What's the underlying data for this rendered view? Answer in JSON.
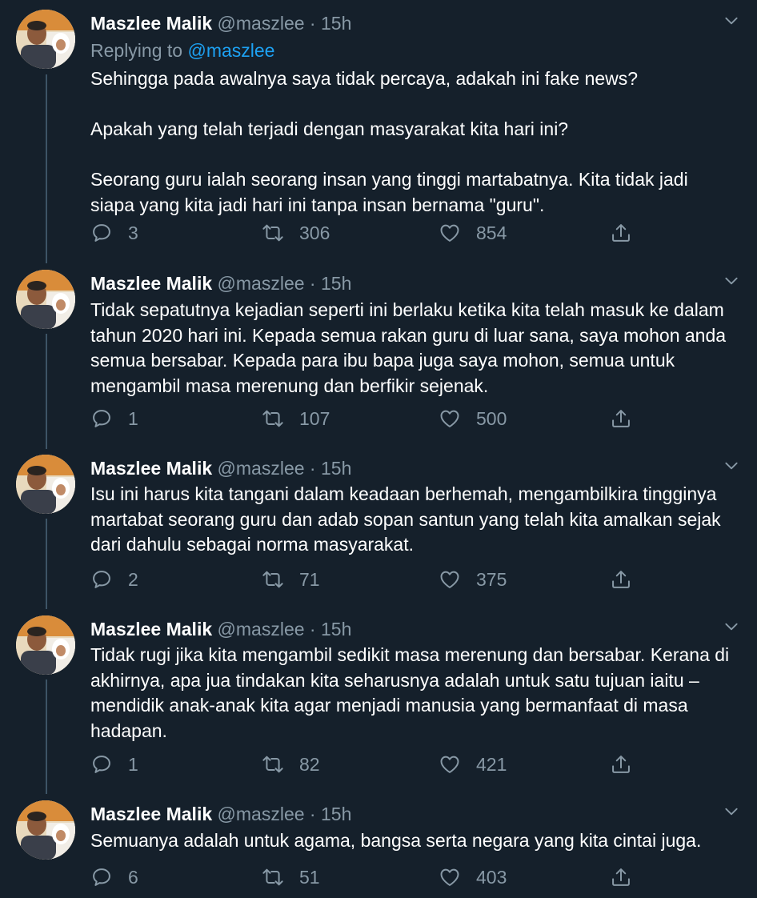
{
  "tweets": [
    {
      "name": "Maszlee Malik",
      "handle": "@maszlee",
      "dot": "·",
      "time": "15h",
      "replying_prefix": "Replying to",
      "replying_mention": "@maszlee",
      "paragraphs": [
        "Sehingga pada awalnya saya tidak percaya, adakah ini fake news?",
        "Apakah yang telah terjadi dengan masyarakat kita hari ini?",
        "Seorang guru ialah seorang insan yang tinggi martabatnya. Kita tidak jadi siapa yang kita jadi hari ini tanpa insan bernama \"guru\"."
      ],
      "replies": "3",
      "retweets": "306",
      "likes": "854"
    },
    {
      "name": "Maszlee Malik",
      "handle": "@maszlee",
      "dot": "·",
      "time": "15h",
      "paragraphs": [
        "Tidak sepatutnya kejadian seperti ini berlaku ketika kita telah masuk ke dalam tahun 2020 hari ini. Kepada semua rakan guru di luar sana, saya mohon anda semua bersabar. Kepada para ibu bapa juga saya mohon, semua untuk mengambil masa merenung dan berfikir sejenak."
      ],
      "replies": "1",
      "retweets": "107",
      "likes": "500"
    },
    {
      "name": "Maszlee Malik",
      "handle": "@maszlee",
      "dot": "·",
      "time": "15h",
      "paragraphs": [
        "Isu ini harus kita tangani dalam keadaan berhemah, mengambilkira tingginya martabat seorang guru dan adab sopan santun yang telah kita amalkan sejak dari dahulu sebagai norma masyarakat."
      ],
      "replies": "2",
      "retweets": "71",
      "likes": "375"
    },
    {
      "name": "Maszlee Malik",
      "handle": "@maszlee",
      "dot": "·",
      "time": "15h",
      "paragraphs": [
        "Tidak rugi jika kita mengambil sedikit masa merenung dan bersabar. Kerana di akhirnya, apa jua tindakan kita seharusnya adalah untuk satu tujuan iaitu – mendidik anak-anak kita agar menjadi manusia yang bermanfaat di masa hadapan."
      ],
      "replies": "1",
      "retweets": "82",
      "likes": "421"
    },
    {
      "name": "Maszlee Malik",
      "handle": "@maszlee",
      "dot": "·",
      "time": "15h",
      "paragraphs": [
        "Semuanya adalah untuk agama, bangsa serta negara yang kita cintai juga."
      ],
      "replies": "6",
      "retweets": "51",
      "likes": "403"
    }
  ],
  "icons": {
    "reply": "reply-icon",
    "retweet": "retweet-icon",
    "like": "heart-icon",
    "share": "share-icon",
    "caret": "chevron-down-icon"
  },
  "colors": {
    "background": "#15202b",
    "secondary_text": "#8899a6",
    "mention": "#1da1f2",
    "thread_line": "#3d5466"
  }
}
